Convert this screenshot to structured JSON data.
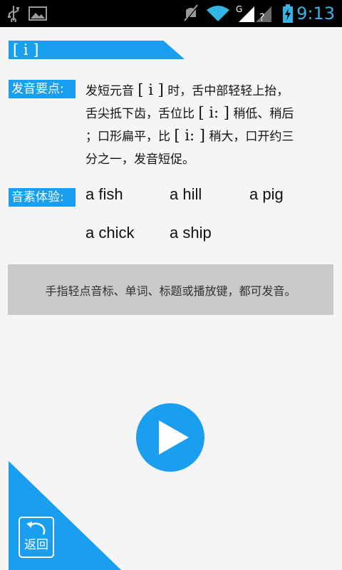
{
  "status_bar": {
    "time": "9:13",
    "icons": [
      "usb-icon",
      "image-icon",
      "mute-icon",
      "wifi-icon",
      "signal-icon",
      "battery-charging-icon"
    ]
  },
  "phoneme": {
    "symbol": "[ i ]"
  },
  "pronunciation": {
    "label": "发音要点:",
    "lines": [
      {
        "pre": "发短元音 ",
        "ipa": "[ i ]",
        "post": " 时，舌中部轻轻上抬，"
      },
      {
        "pre": "舌尖抵下齿，舌位比 ",
        "ipa": "[ i: ]",
        "post": " 稍低、稍后"
      },
      {
        "pre": "；口形扁平，比 ",
        "ipa": "[ i: ]",
        "post": " 稍大，口开约三"
      },
      {
        "pre": "分之一，发音短促。",
        "ipa": "",
        "post": ""
      }
    ]
  },
  "experience": {
    "label": "音素体验:",
    "words": [
      "a fish",
      "a hill",
      "a pig",
      "a chick",
      "a ship"
    ]
  },
  "hint": "手指轻点音标、单词、标题或播放键，都可发音。",
  "back_label": "返回",
  "colors": {
    "accent": "#1a9ff0",
    "background": "#f5f5f5",
    "hint_bg": "#c9c9c9",
    "status_time": "#33b5e5"
  }
}
